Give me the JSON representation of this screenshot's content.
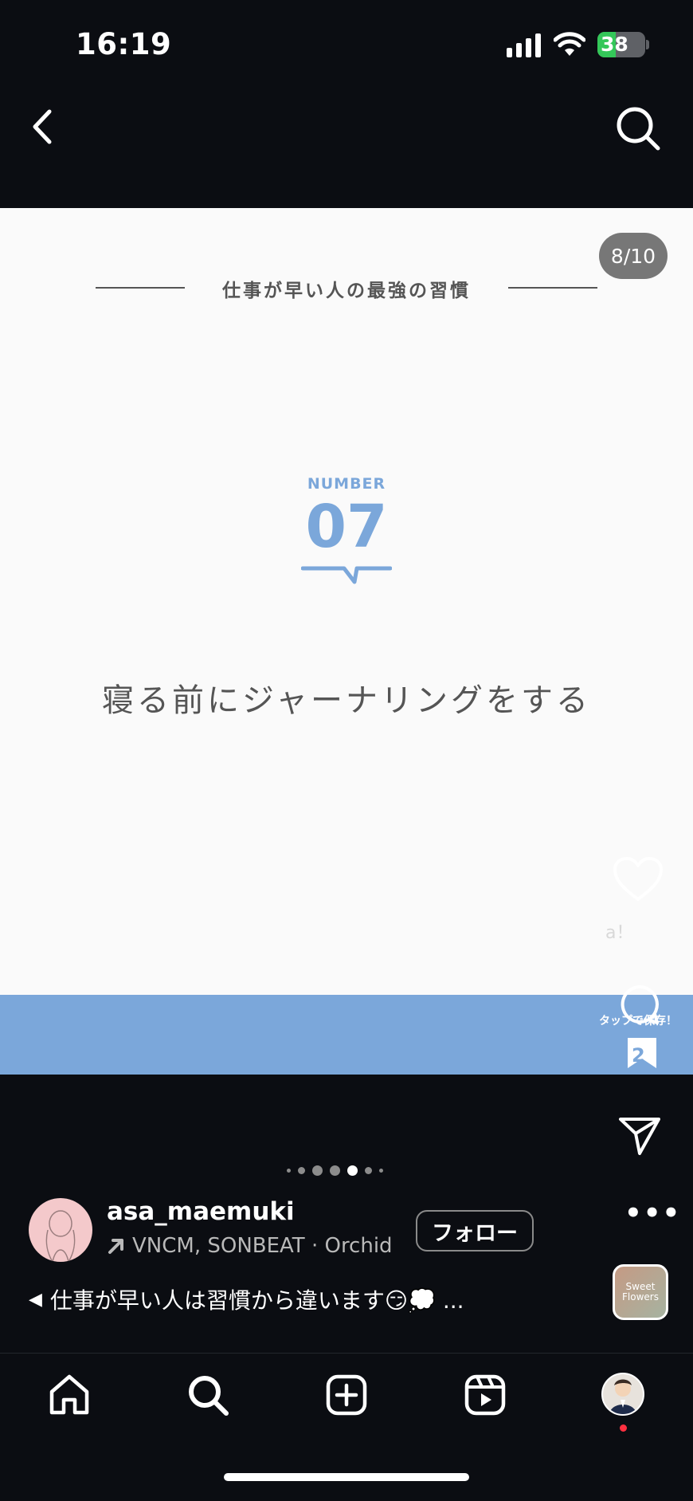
{
  "status_bar": {
    "time": "16:19",
    "battery": "38"
  },
  "post": {
    "counter": "8/10",
    "slide": {
      "title": "仕事が早い人の最強の習慣",
      "number_label": "NUMBER",
      "number": "07",
      "heading": "寝る前にジャーナリングをする"
    },
    "actions": {
      "like_count": "a！",
      "save_hint": "タップで保存！",
      "bookmark_count": "2",
      "more": "•••",
      "music_thumb": "Sweet Flowers"
    },
    "carousel": {
      "total": 7,
      "active": 4
    },
    "user": {
      "username": "asa_maemuki",
      "music": "VNCM, SONBEAT · Orchid",
      "follow_label": "フォロー"
    },
    "caption": {
      "marker": "◀",
      "text": "仕事が早い人は習慣から違います😏💭 ..."
    }
  },
  "bottom_nav": [
    "home-icon",
    "search-icon",
    "create-icon",
    "reels-icon",
    "profile-avatar"
  ],
  "colors": {
    "accent": "#7ba7da",
    "background": "#0b0d12",
    "slide": "#fafafa"
  }
}
